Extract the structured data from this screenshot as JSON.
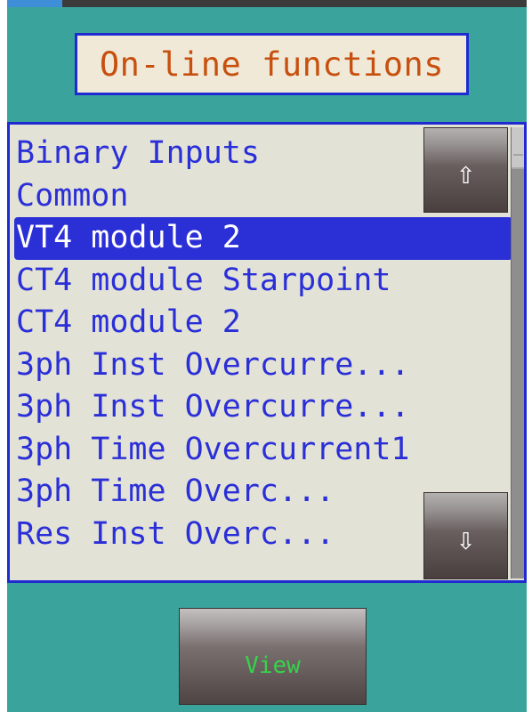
{
  "header": {
    "title": "On-line functions"
  },
  "list": {
    "items": [
      {
        "label": "Binary Inputs",
        "selected": false
      },
      {
        "label": "Common",
        "selected": false
      },
      {
        "label": "VT4 module 2",
        "selected": true
      },
      {
        "label": "CT4 module Starpoint",
        "selected": false
      },
      {
        "label": "CT4 module 2",
        "selected": false
      },
      {
        "label": "3ph Inst Overcurre...",
        "selected": false
      },
      {
        "label": "3ph Inst Overcurre...",
        "selected": false
      },
      {
        "label": "3ph Time Overcurrent1",
        "selected": false
      },
      {
        "label": "3ph Time Overc...",
        "selected": false
      },
      {
        "label": "Res Inst Overc...",
        "selected": false
      }
    ]
  },
  "scroll": {
    "up_icon": "arrow-up-icon",
    "up_glyph": "⇧",
    "down_icon": "arrow-down-icon",
    "down_glyph": "⇩"
  },
  "footer": {
    "view_label": "View"
  },
  "colors": {
    "background": "#3aa39c",
    "list_text": "#2a2fd8",
    "selection": "#2b2fd6",
    "title_text": "#c8500f",
    "border": "#1f2bd0",
    "view_text": "#36d34a"
  }
}
